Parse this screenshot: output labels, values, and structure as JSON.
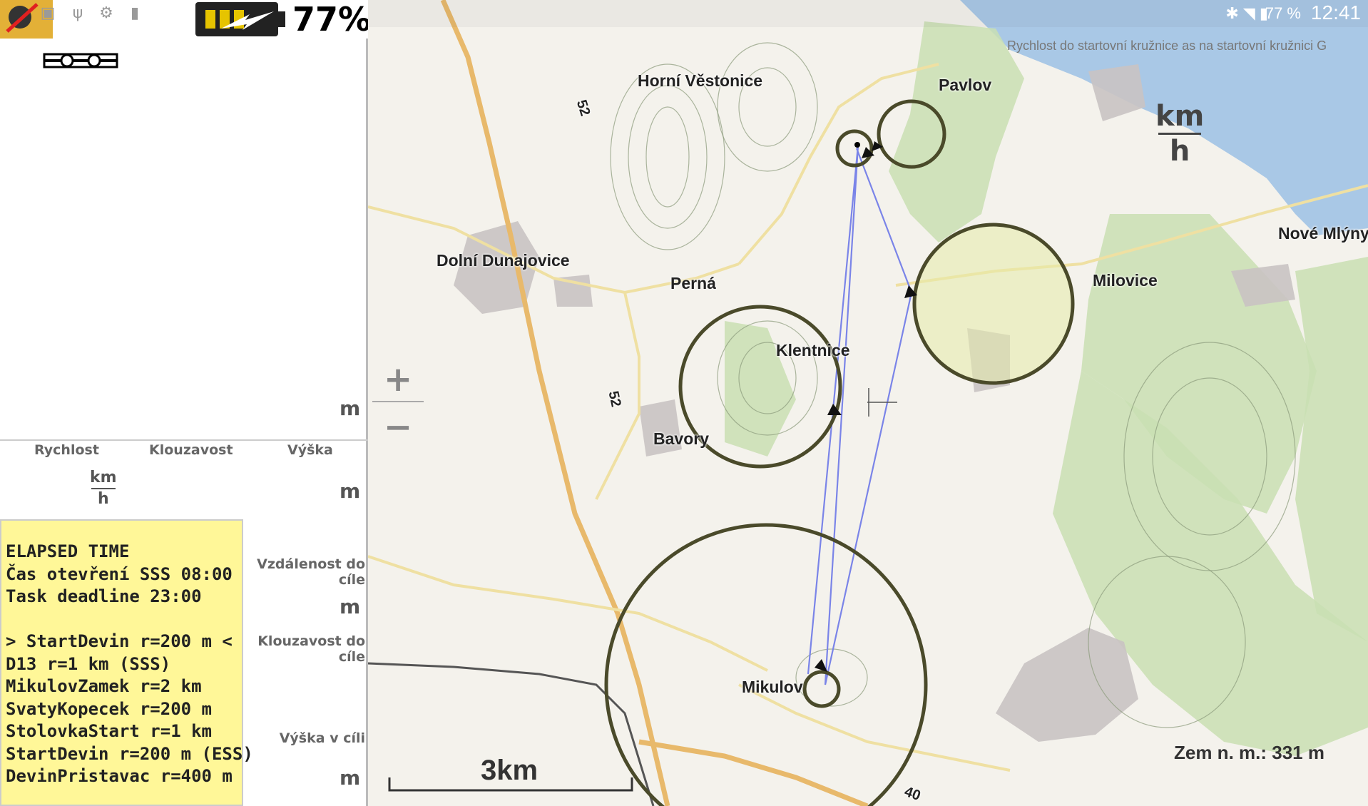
{
  "status_bar": {
    "battery_percent": "77%",
    "system_battery_percent": "77 %",
    "time": "12:41",
    "icons": [
      "app-icon",
      "image-icon",
      "usb-icon",
      "settings-icon",
      "sdcard-icon",
      "bluetooth-icon",
      "wifi-icon",
      "battery-icon"
    ]
  },
  "left_panel": {
    "unit_top": "m",
    "columns": [
      "Rychlost",
      "Klouzavost",
      "Výška"
    ],
    "speed_unit_num": "km",
    "speed_unit_den": "h",
    "height_unit": "m",
    "distance_label": "Vzdálenost do cíle",
    "distance_unit": "m",
    "glide_label": "Klouzavost do cíle",
    "goal_height_label": "Výška v cíli",
    "goal_height_unit": "m"
  },
  "task_box": {
    "lines": [
      "ELAPSED TIME",
      "Čas otevření SSS 08:00",
      "Task deadline 23:00",
      "",
      "> StartDevin r=200 m <",
      "D13 r=1 km (SSS)",
      "MikulovZamek r=2 km",
      "SvatyKopecek r=200 m",
      "StolovkaStart r=1 km",
      "StartDevin r=200 m (ESS)",
      "DevinPristavac r=400 m"
    ]
  },
  "map": {
    "info_line": "Rychlost do startovní kružnice  as na startovní kružnici G",
    "speed_unit_num": "km",
    "speed_unit_den": "h",
    "towns": {
      "horni_vestonice": "Horní Věstonice",
      "pavlov": "Pavlov",
      "dolni_dunajovice": "Dolní Dunajovice",
      "perna": "Perná",
      "klentnice": "Klentnice",
      "milovice": "Milovice",
      "nove_mlyny": "Nové Mlýny",
      "bavory": "Bavory",
      "mikulov": "Mikulov"
    },
    "road_labels": [
      "52",
      "52",
      "40"
    ],
    "zoom_in": "+",
    "zoom_out": "−",
    "scale": "3km",
    "ground_altitude": "Zem n. m.: 331 m",
    "colors": {
      "water": "#a9c8e6",
      "forest": "#c9dfb3",
      "road_major": "#e8b96b",
      "road_minor": "#f0e2a8",
      "task_circle": "#4a4a2a",
      "task_line": "#7a84e8",
      "panel_highlight": "#fff798"
    }
  }
}
